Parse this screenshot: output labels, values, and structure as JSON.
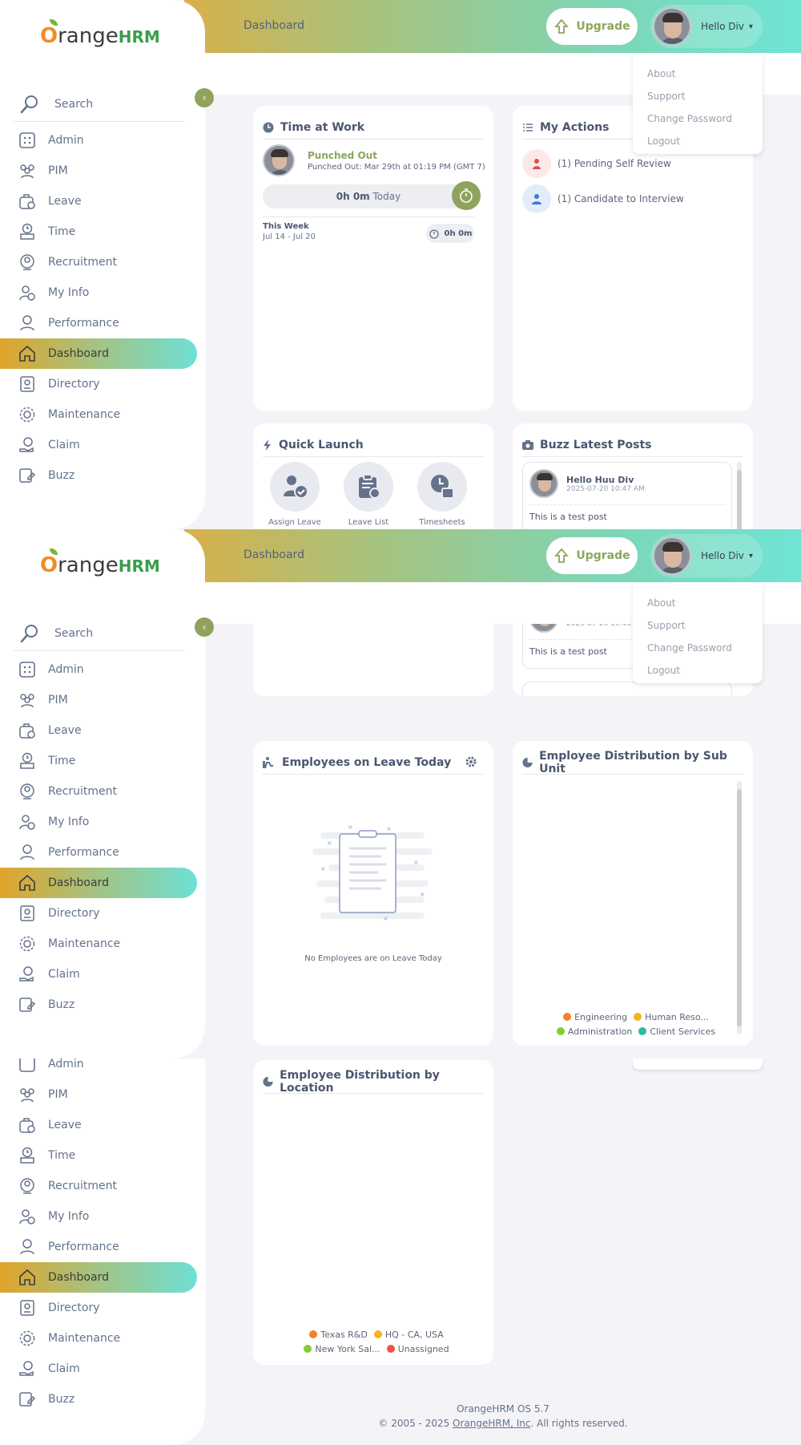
{
  "brand": {
    "logo_o": "O",
    "logo_text": "range",
    "logo_hrm": "HRM"
  },
  "sidebar": {
    "search_label": "Search",
    "toggle_icon": "‹",
    "items": [
      {
        "label": "Admin",
        "icon": "admin-icon"
      },
      {
        "label": "PIM",
        "icon": "pim-icon"
      },
      {
        "label": "Leave",
        "icon": "leave-icon"
      },
      {
        "label": "Time",
        "icon": "time-icon"
      },
      {
        "label": "Recruitment",
        "icon": "recruitment-icon"
      },
      {
        "label": "My Info",
        "icon": "my-info-icon"
      },
      {
        "label": "Performance",
        "icon": "performance-icon"
      },
      {
        "label": "Dashboard",
        "icon": "dashboard-icon",
        "active": true
      },
      {
        "label": "Directory",
        "icon": "directory-icon"
      },
      {
        "label": "Maintenance",
        "icon": "maintenance-icon"
      },
      {
        "label": "Claim",
        "icon": "claim-icon"
      },
      {
        "label": "Buzz",
        "icon": "buzz-icon"
      }
    ],
    "partial_first_item": "Admin"
  },
  "header": {
    "title": "Dashboard",
    "upgrade_label": "Upgrade",
    "user_name": "Hello Div",
    "caret": "▾"
  },
  "user_menu": [
    "About",
    "Support",
    "Change Password",
    "Logout"
  ],
  "time_at_work": {
    "title": "Time at Work",
    "status": "Punched Out",
    "punched_out": "Punched Out: Mar 29th at 01:19 PM (GMT 7)",
    "today_value": "0h 0m",
    "today_label": "Today",
    "week_title": "This Week",
    "week_range": "Jul 14 - Jul 20",
    "week_total": "0h 0m"
  },
  "my_actions": {
    "title": "My Actions",
    "items": [
      "(1) Pending Self Review",
      "(1) Candidate to Interview"
    ]
  },
  "quick_launch": {
    "title": "Quick Launch",
    "items": [
      "Assign Leave",
      "Leave List",
      "Timesheets"
    ]
  },
  "buzz": {
    "title": "Buzz Latest Posts",
    "post_author": "Hello Huu Div",
    "post_time": "2025-07-20 10:47 AM",
    "post_time_clipped": "2025-07-20 10:45",
    "post_text": "This is a test post"
  },
  "leave_today": {
    "title": "Employees on Leave Today",
    "empty_text": "No Employees are on Leave Today"
  },
  "sub_unit": {
    "title": "Employee Distribution by Sub Unit",
    "legend": [
      {
        "name": "Engineering",
        "color": "#f67f29"
      },
      {
        "name": "Human Reso...",
        "color": "#f8b21a"
      },
      {
        "name": "Administration",
        "color": "#84cc33"
      },
      {
        "name": "Client Services",
        "color": "#2ebaa0"
      }
    ]
  },
  "location": {
    "title": "Employee Distribution by Location",
    "legend": [
      {
        "name": "Texas R&D",
        "color": "#f67f29"
      },
      {
        "name": "HQ - CA, USA",
        "color": "#f8b21a"
      },
      {
        "name": "New York Sal...",
        "color": "#84cc33"
      },
      {
        "name": "Unassigned",
        "color": "#f4504b"
      }
    ]
  },
  "footer": {
    "version": "OrangeHRM OS 5.7",
    "copyright_prefix": "© 2005 - 2025 ",
    "company_link": "OrangeHRM, Inc",
    "copyright_suffix": ". All rights reserved."
  },
  "colors": {
    "accent_green": "#8ea65c",
    "brand_orange": "#f28c28",
    "text": "#64728c"
  }
}
